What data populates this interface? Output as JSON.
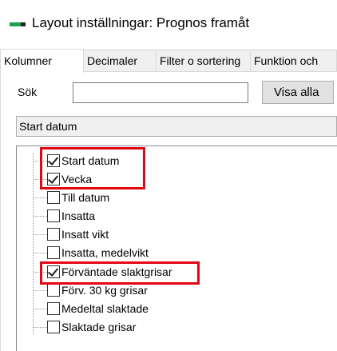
{
  "window": {
    "title": "Layout inställningar: Prognos framåt",
    "icon": "app-logo-icon"
  },
  "tabs": [
    {
      "label": "Kolumner",
      "active": true
    },
    {
      "label": "Decimaler",
      "active": false
    },
    {
      "label": "Filter o sortering",
      "active": false
    },
    {
      "label": "Funktion och",
      "active": false
    }
  ],
  "search": {
    "label": "Sök",
    "value": "",
    "placeholder": "",
    "show_all_label": "Visa alla"
  },
  "combo": {
    "selected": "Start datum"
  },
  "tree": {
    "items": [
      {
        "label": "Start datum",
        "checked": true
      },
      {
        "label": "Vecka",
        "checked": true
      },
      {
        "label": "Till datum",
        "checked": false
      },
      {
        "label": "Insatta",
        "checked": false
      },
      {
        "label": "Insatt vikt",
        "checked": false
      },
      {
        "label": "Insatta, medelvikt",
        "checked": false
      },
      {
        "label": "Förväntade slaktgrisar",
        "checked": true
      },
      {
        "label": "Förv. 30 kg grisar",
        "checked": false
      },
      {
        "label": "Medeltal slaktade",
        "checked": false
      },
      {
        "label": "Slaktade grisar",
        "checked": false
      }
    ]
  },
  "colors": {
    "highlight": "#e30613",
    "accent_green": "#1aa34a"
  }
}
